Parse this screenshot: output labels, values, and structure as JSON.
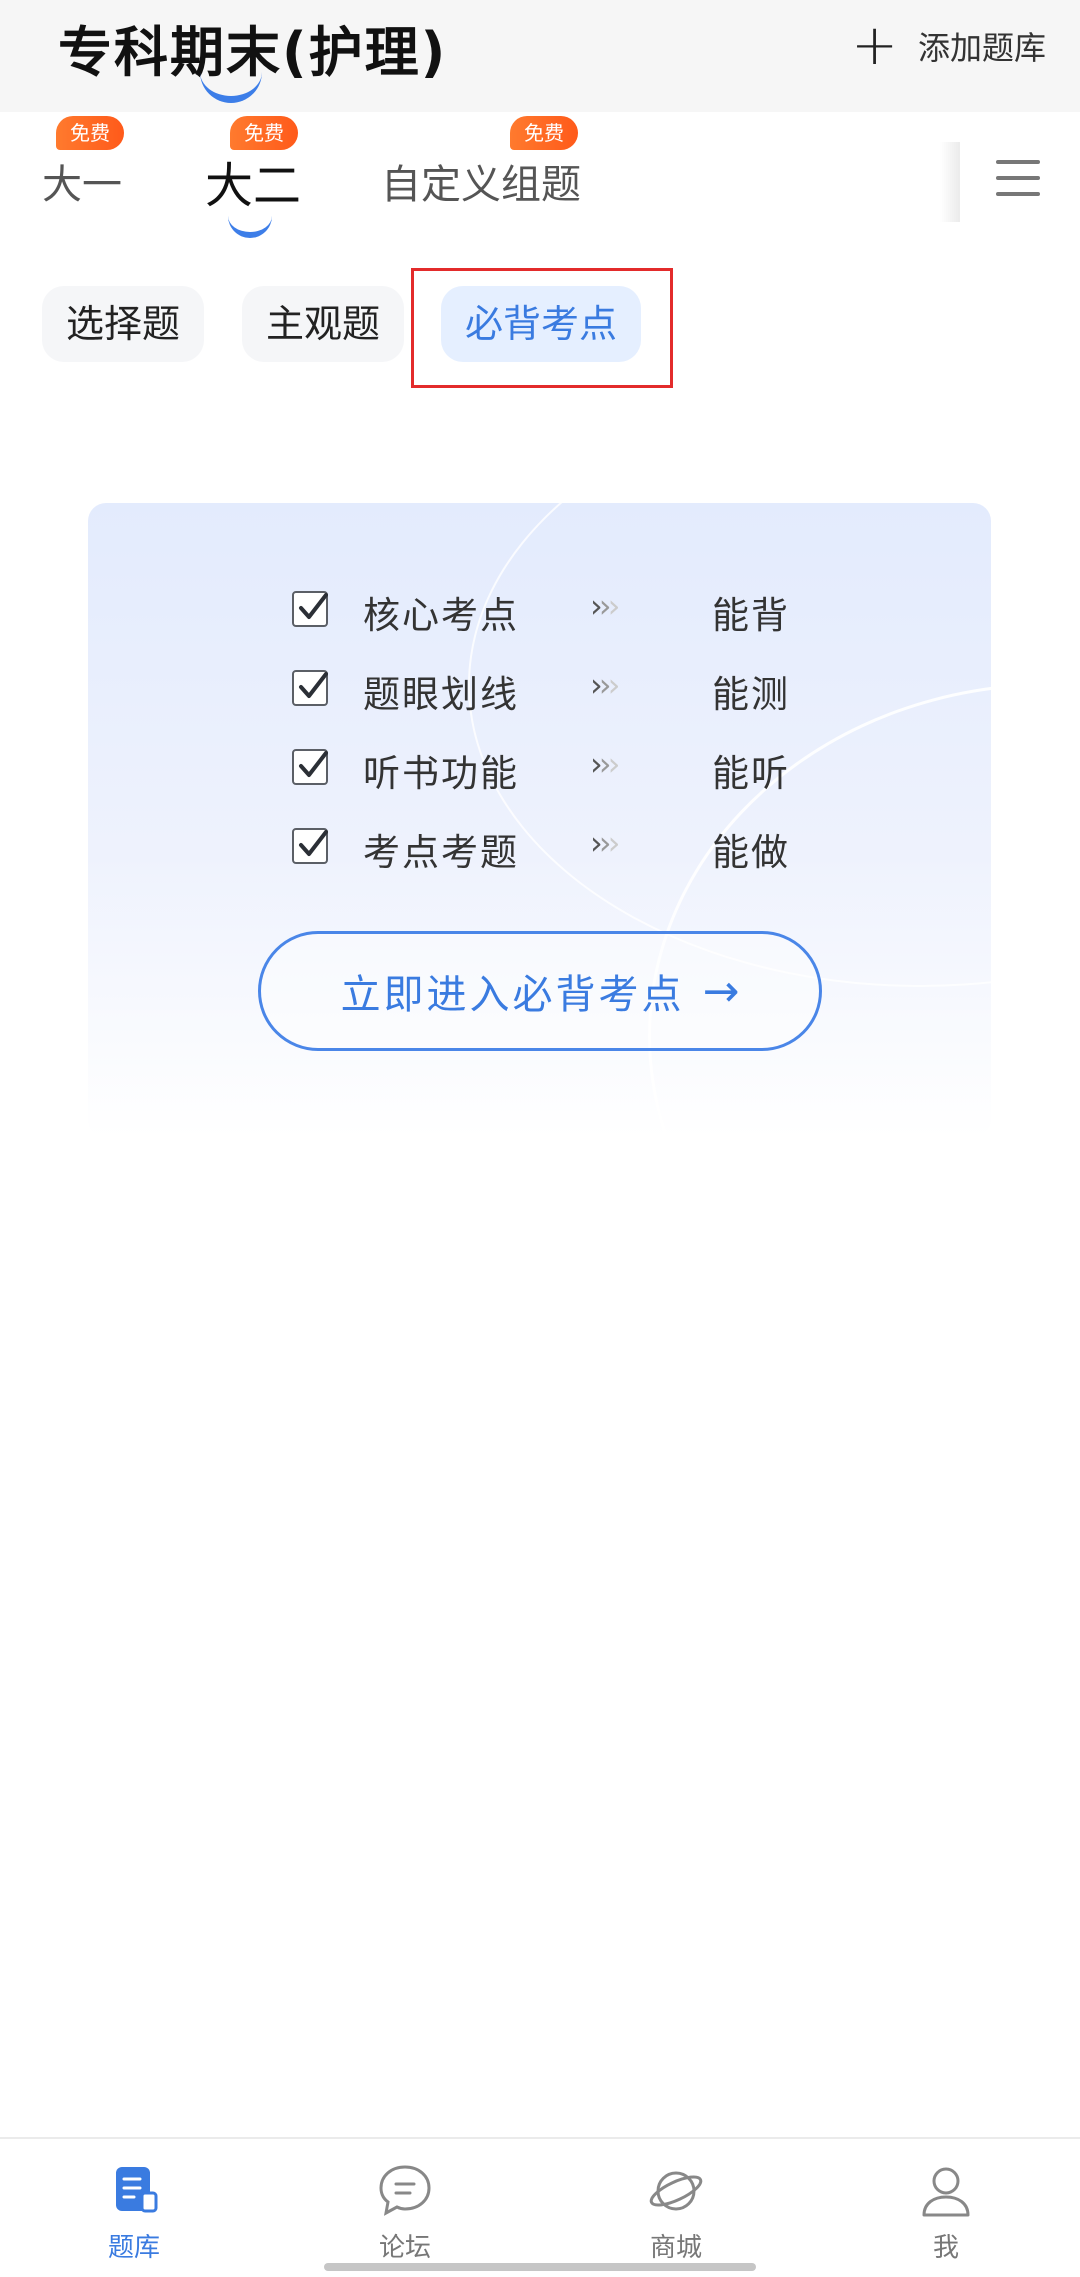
{
  "header": {
    "title": "专科期末(护理)",
    "add_label": "添加题库",
    "add_icon": "plus-icon"
  },
  "tabs": [
    {
      "label": "大一",
      "badge": "免费"
    },
    {
      "label": "大二",
      "badge": "免费"
    },
    {
      "label": "自定义组题",
      "badge": "免费"
    }
  ],
  "menu_icon": "hamburger-menu-icon",
  "subtabs": [
    {
      "label": "选择题"
    },
    {
      "label": "主观题"
    },
    {
      "label": "必背考点"
    }
  ],
  "promo": {
    "features": [
      {
        "label": "核心考点",
        "value": "能背"
      },
      {
        "label": "题眼划线",
        "value": "能测"
      },
      {
        "label": "听书功能",
        "value": "能听"
      },
      {
        "label": "考点考题",
        "value": "能做"
      }
    ],
    "cta_label": "立即进入必背考点",
    "cta_arrow": "→"
  },
  "bottom_nav": [
    {
      "label": "题库",
      "icon": "question-bank-icon"
    },
    {
      "label": "论坛",
      "icon": "chat-bubble-icon"
    },
    {
      "label": "商城",
      "icon": "planet-icon"
    },
    {
      "label": "我",
      "icon": "person-icon"
    }
  ],
  "colors": {
    "accent": "#3a7be0",
    "badge": "#ff6a22",
    "highlight": "#e32b2b"
  }
}
